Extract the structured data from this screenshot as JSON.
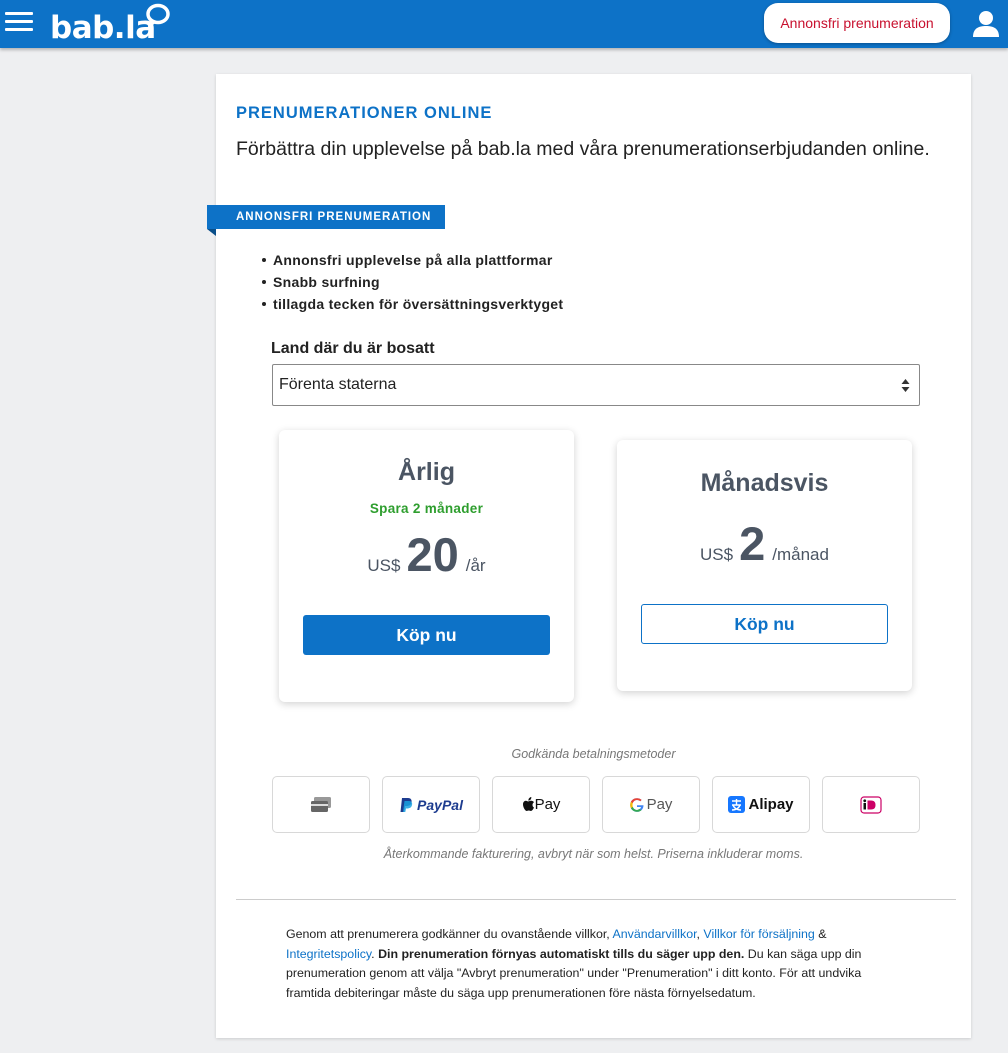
{
  "header": {
    "logo": "bab.la",
    "promo_button": "Annonsfri prenumeration",
    "menu_icon": "hamburger-menu-icon",
    "user_icon": "user-icon",
    "accent_color": "#0d72c7"
  },
  "main": {
    "eyebrow": "PRENUMERATIONER ONLINE",
    "subtitle": "Förbättra din upplevelse på bab.la med våra prenumerationserbjudanden online.",
    "ribbon": "ANNONSFRI PRENUMERATION",
    "features": [
      "Annonsfri upplevelse på alla plattformar",
      "Snabb surfning",
      "tillagda tecken för översättningsverktyget"
    ],
    "country": {
      "label": "Land där du är bosatt",
      "selected": "Förenta staterna"
    },
    "plans": [
      {
        "title": "Årlig",
        "save": "Spara 2 månader",
        "currency": "US$",
        "price": "20",
        "period": "/år",
        "button": "Köp nu"
      },
      {
        "title": "Månadsvis",
        "currency": "US$",
        "price": "2",
        "period": "/månad",
        "button": "Köp nu"
      }
    ],
    "payment": {
      "caption": "Godkända betalningsmetoder",
      "methods": [
        "card-icon",
        "PayPal",
        "Pay",
        "Pay",
        "Alipay",
        "ideal-icon"
      ],
      "note": "Återkommande fakturering, avbryt när som helst. Priserna inkluderar moms."
    },
    "terms": {
      "p1": "Genom att prenumerera godkänner du ovanstående villkor, ",
      "link1": "Användarvillkor",
      "sep1": ", ",
      "link2": "Villkor för försäljning",
      "sep2": " & ",
      "link3": "Integritetspolicy",
      "p2": ". ",
      "bold": "Din prenumeration förnyas automatiskt tills du säger upp den.",
      "p3": " Du kan säga upp din prenumeration genom att välja \"Avbryt prenumeration\" under \"Prenumeration\" i ditt konto. För att undvika framtida debiteringar måste du säga upp prenumerationen före nästa förnyelsedatum."
    }
  }
}
